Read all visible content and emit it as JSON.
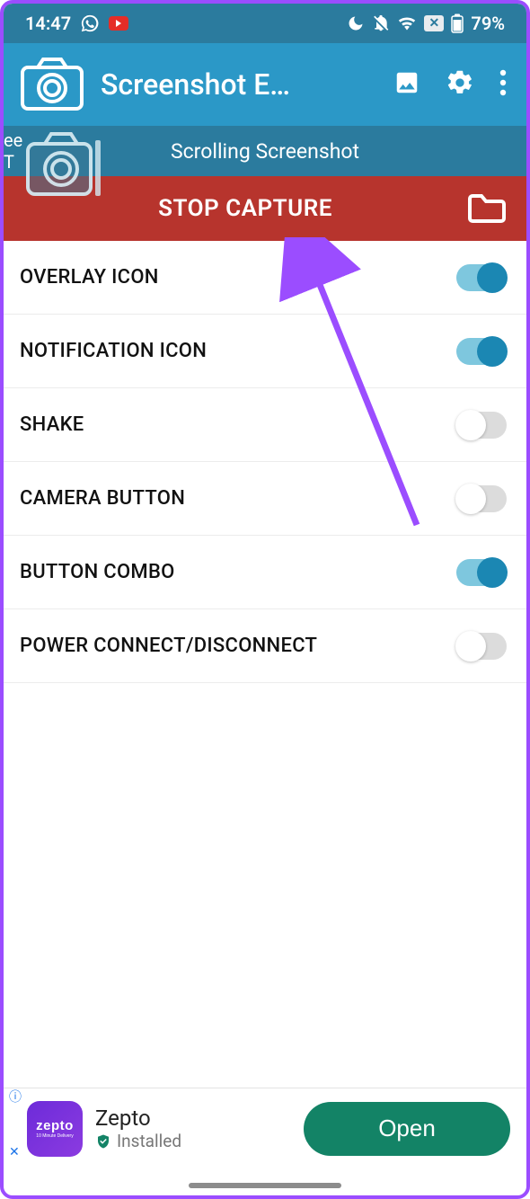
{
  "statusbar": {
    "time": "14:47",
    "battery": "79%"
  },
  "appbar": {
    "title": "Screenshot E…"
  },
  "tabbar": {
    "left_stub": "ee T",
    "label": "Scrolling Screenshot"
  },
  "stopbar": {
    "label": "STOP CAPTURE"
  },
  "settings": [
    {
      "label": "OVERLAY ICON",
      "on": true
    },
    {
      "label": "NOTIFICATION ICON",
      "on": true
    },
    {
      "label": "SHAKE",
      "on": false
    },
    {
      "label": "CAMERA BUTTON",
      "on": false
    },
    {
      "label": "BUTTON COMBO",
      "on": true
    },
    {
      "label": "POWER CONNECT/DISCONNECT",
      "on": false
    }
  ],
  "ad": {
    "brand": "zepto",
    "name": "Zepto",
    "status": "Installed",
    "cta": "Open"
  }
}
